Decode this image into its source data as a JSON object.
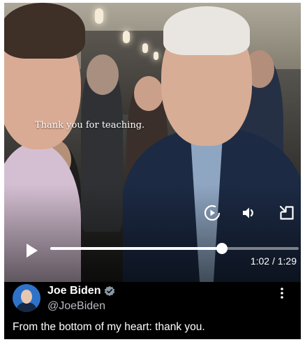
{
  "video": {
    "caption": "Thank you for teaching.",
    "time_display": "1:02 / 1:29",
    "progress_fraction": 0.69,
    "controls": {
      "play_icon": "play-icon",
      "replay_icon": "replay-icon",
      "volume_icon": "volume-icon",
      "popout_icon": "popout-icon"
    }
  },
  "post": {
    "author_name": "Joe Biden",
    "handle": "@JoeBiden",
    "verified_badge_icon": "verified-badge-icon",
    "more_icon": "more-options-icon",
    "text": "From the bottom of my heart: thank you."
  },
  "colors": {
    "background": "#000000",
    "text": "#ffffff",
    "handle_text": "#b9bcc0",
    "verified_badge": "#8b98a5"
  }
}
